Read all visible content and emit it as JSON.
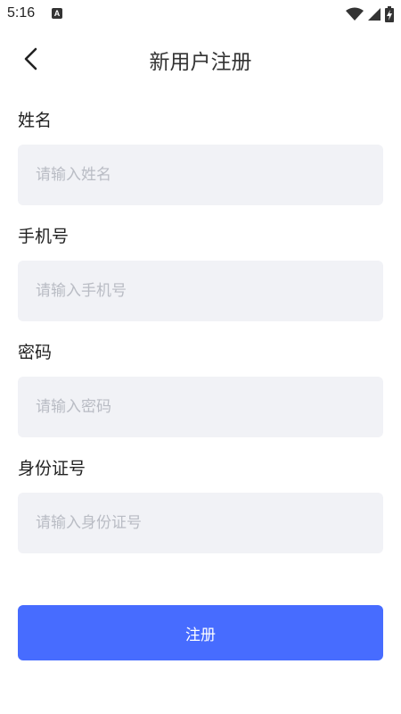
{
  "status_bar": {
    "time": "5:16",
    "notification_badge": "A",
    "icons": [
      "wifi-icon",
      "cellular-signal-icon",
      "battery-charging-icon"
    ]
  },
  "header": {
    "title": "新用户注册",
    "back_icon": "chevron-left-icon"
  },
  "form": {
    "fields": [
      {
        "label": "姓名",
        "placeholder": "请输入姓名",
        "value": ""
      },
      {
        "label": "手机号",
        "placeholder": "请输入手机号",
        "value": ""
      },
      {
        "label": "密码",
        "placeholder": "请输入密码",
        "value": ""
      },
      {
        "label": "身份证号",
        "placeholder": "请输入身份证号",
        "value": ""
      }
    ],
    "submit_label": "注册"
  },
  "colors": {
    "primary": "#476cff",
    "input_background": "#f1f2f6",
    "placeholder": "#b9bcc4"
  }
}
